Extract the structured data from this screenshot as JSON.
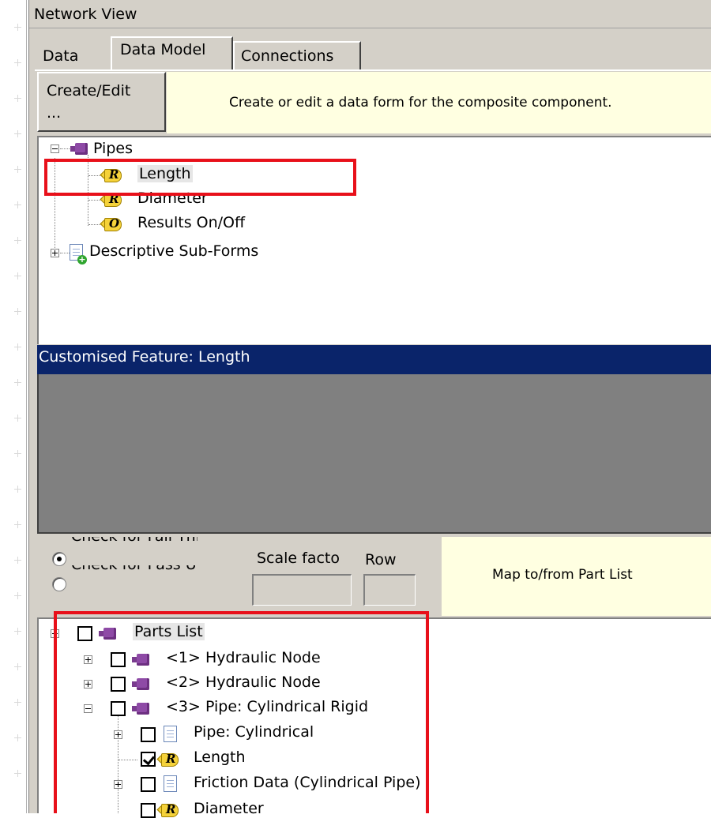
{
  "window": {
    "title": "Network View"
  },
  "tabs": [
    {
      "label": "Data",
      "active": false
    },
    {
      "label": "Data Model",
      "active": true
    },
    {
      "label": "Connections",
      "active": false
    }
  ],
  "create_edit": {
    "button_line1": "Create/Edit",
    "button_line2": "...",
    "description": "Create or edit a data form for the composite component."
  },
  "model_tree": {
    "root": "Pipes",
    "children": [
      {
        "label": "Length",
        "icon": "R",
        "selected": true
      },
      {
        "label": "Diameter",
        "icon": "R"
      },
      {
        "label": "Results On/Off",
        "icon": "O"
      }
    ],
    "sub_forms": "Descriptive Sub-Forms"
  },
  "feature_panel": {
    "header": "Customised Feature: Length"
  },
  "options": {
    "radio1": "Check for Fail Thru",
    "radio2": "Check for Pass Up",
    "radio1_selected": true,
    "scale_label": "Scale facto",
    "row_label": "Row",
    "map_label": "Map to/from Part List"
  },
  "parts_tree": {
    "root": "Parts List",
    "items": [
      "<1> Hydraulic Node",
      "<2> Hydraulic Node",
      "<3> Pipe: Cylindrical Rigid",
      "Pipe: Cylindrical",
      "Length",
      "Friction Data (Cylindrical Pipe)",
      "Diameter"
    ]
  },
  "colors": {
    "highlight_box": "#e8101a",
    "feature_header_bg": "#0a246a",
    "tooltip_bg": "#ffffe1"
  }
}
